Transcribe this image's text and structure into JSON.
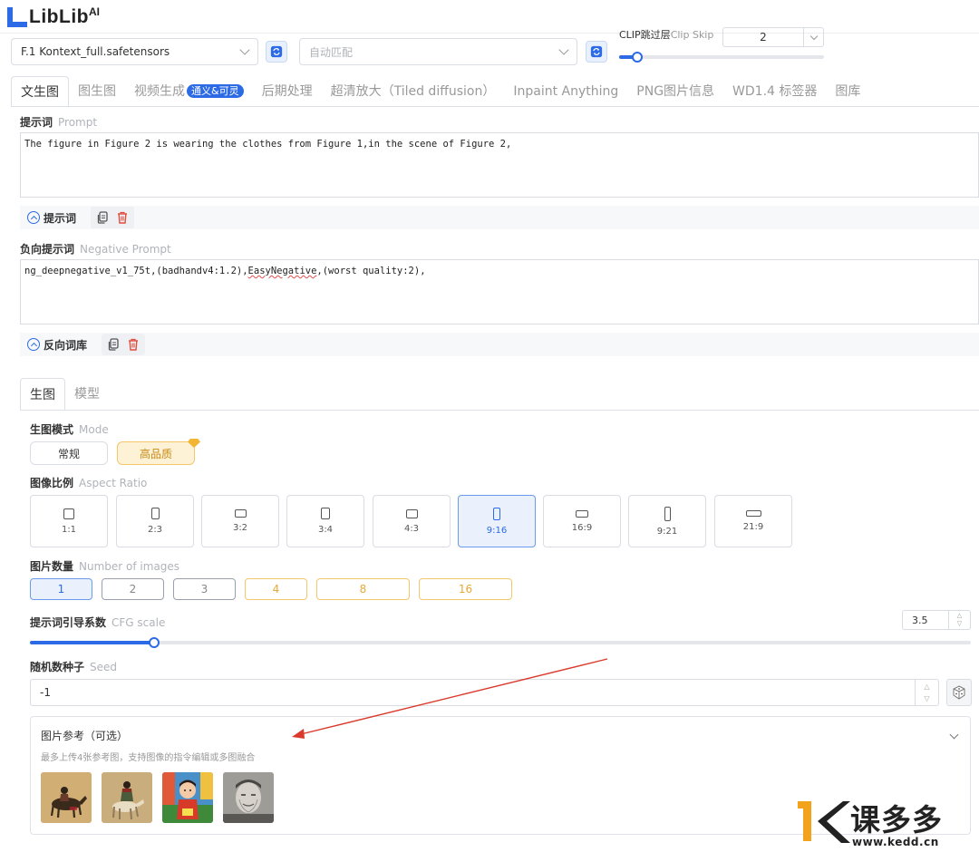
{
  "logo": {
    "text": "LibLib",
    "sup": "AI"
  },
  "model_select": {
    "value": "F.1 Kontext_full.safetensors"
  },
  "vae_select": {
    "placeholder": "自动匹配"
  },
  "clip_skip": {
    "label": "CLIP跳过层",
    "label_en": "Clip Skip",
    "value": "2",
    "fill_fraction": 0.09
  },
  "tabs": [
    {
      "label": "文生图",
      "active": true
    },
    {
      "label": "图生图"
    },
    {
      "label": "视频生成",
      "badge": "通义&可灵"
    },
    {
      "label": "后期处理"
    },
    {
      "label": "超清放大（Tiled diffusion）"
    },
    {
      "label": "Inpaint Anything"
    },
    {
      "label": "PNG图片信息"
    },
    {
      "label": "WD1.4 标签器"
    },
    {
      "label": "图库"
    }
  ],
  "prompt": {
    "label": "提示词",
    "label_en": "Prompt",
    "text": "The figure in Figure 2 is wearing the clothes from Figure 1,in the scene of Figure 2,",
    "toolbar_label": "提示词"
  },
  "negative_prompt": {
    "label": "负向提示词",
    "label_en": "Negative Prompt",
    "text_before": "ng_deepnegative_v1_75t,(badhandv4:1.2),",
    "text_flagged": "EasyNegative",
    "text_after": ",(worst quality:2),",
    "toolbar_label": "反向词库"
  },
  "inner_tabs": [
    {
      "label": "生图",
      "active": true
    },
    {
      "label": "模型"
    }
  ],
  "mode": {
    "label": "生图模式",
    "label_en": "Mode",
    "options": [
      "常规",
      "高品质"
    ],
    "selected": "高品质"
  },
  "aspect_ratio": {
    "label": "图像比例",
    "label_en": "Aspect Ratio",
    "options": [
      "1:1",
      "2:3",
      "3:2",
      "3:4",
      "4:3",
      "9:16",
      "16:9",
      "9:21",
      "21:9"
    ],
    "selected": "9:16"
  },
  "num_images": {
    "label": "图片数量",
    "label_en": "Number of images",
    "options": [
      "1",
      "2",
      "3",
      "4",
      "8",
      "16"
    ],
    "selected": "1"
  },
  "cfg": {
    "label": "提示词引导系数",
    "label_en": "CFG scale",
    "value": "3.5",
    "fill_fraction": 0.132
  },
  "seed": {
    "label": "随机数种子",
    "label_en": "Seed",
    "value": "-1"
  },
  "image_reference": {
    "title": "图片参考（可选）",
    "subtitle": "最多上传4张参考图，支持图像的指令编辑或多图融合",
    "thumbnails": [
      "painting-horse-rider-1",
      "painting-horse-rider-2",
      "child-photo",
      "elder-sketch"
    ]
  },
  "watermark": {
    "text": "课多多",
    "url": "www.kedd.cn"
  },
  "colors": {
    "accent": "#2c6ae6",
    "gold": "#e6a937",
    "arrow": "#d93a2b"
  }
}
